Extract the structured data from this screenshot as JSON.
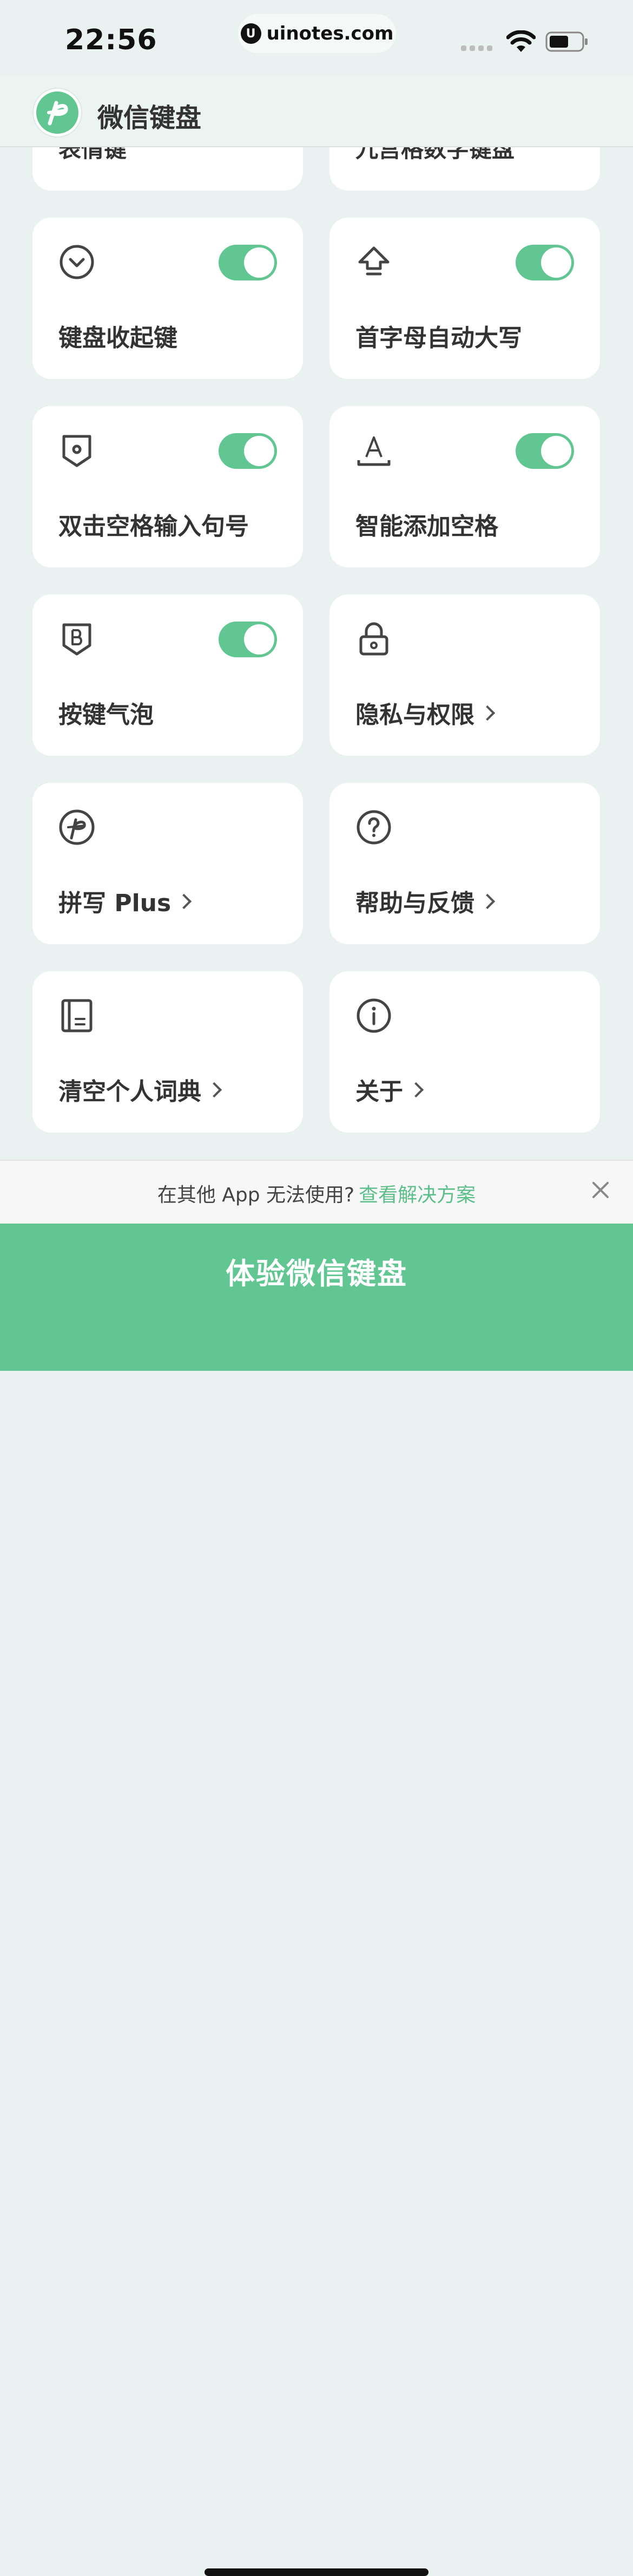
{
  "status_bar": {
    "time": "22:56",
    "url": "uinotes.com",
    "url_logo": "U"
  },
  "header": {
    "title": "微信键盘",
    "logo_icon": "pinyin-p-logo"
  },
  "partial_cards": [
    {
      "label": "表情键"
    },
    {
      "label": "九宫格数字键盘"
    }
  ],
  "settings": [
    {
      "label": "键盘收起键",
      "icon": "chevron-circle-down-icon",
      "toggle": true
    },
    {
      "label": "首字母自动大写",
      "icon": "shift-arrow-icon",
      "toggle": true
    },
    {
      "label": "双击空格输入句号",
      "icon": "badge-dot-icon",
      "toggle": true
    },
    {
      "label": "智能添加空格",
      "icon": "letter-a-underline-icon",
      "toggle": true
    },
    {
      "label": "按键气泡",
      "icon": "badge-b-icon",
      "toggle": true
    },
    {
      "label": "隐私与权限",
      "icon": "lock-icon",
      "link": true
    },
    {
      "label": "拼写 Plus",
      "icon": "pinyin-p-circle-icon",
      "link": true
    },
    {
      "label": "帮助与反馈",
      "icon": "question-circle-icon",
      "link": true
    },
    {
      "label": "清空个人词典",
      "icon": "dictionary-icon",
      "link": true
    },
    {
      "label": "关于",
      "icon": "info-circle-icon",
      "link": true
    }
  ],
  "notice": {
    "text": "在其他 App 无法使用?",
    "link": "查看解决方案"
  },
  "cta": {
    "label": "体验微信键盘"
  },
  "colors": {
    "accent": "#62c693",
    "background": "#e9f2f0",
    "card": "#ffffff",
    "text": "#333333"
  }
}
